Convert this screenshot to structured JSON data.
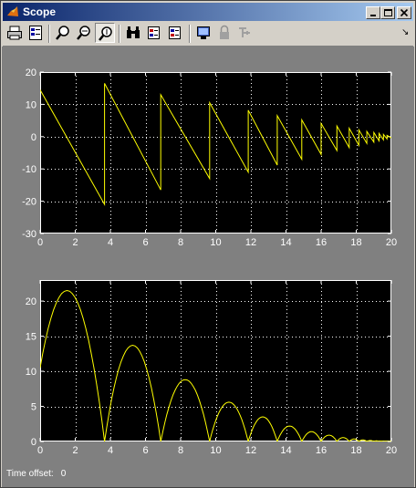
{
  "window": {
    "title": "Scope",
    "title_icon": "matlab-icon"
  },
  "toolbar": {
    "buttons": [
      {
        "name": "print-button",
        "icon": "printer-icon"
      },
      {
        "name": "parameters-button",
        "icon": "parameters-icon"
      },
      {
        "name": "zoom-button",
        "icon": "magnifier-zoom-icon"
      },
      {
        "name": "zoom-x-button",
        "icon": "magnifier-zoom-x-icon"
      },
      {
        "name": "zoom-y-button",
        "icon": "magnifier-zoom-y-icon",
        "pressed": true
      },
      {
        "name": "autoscale-button",
        "icon": "binoculars-icon"
      },
      {
        "name": "save-axes-button",
        "icon": "save-axes-icon"
      },
      {
        "name": "restore-axes-button",
        "icon": "restore-axes-icon"
      },
      {
        "name": "floating-scope-button",
        "icon": "floating-scope-icon"
      },
      {
        "name": "lock-axes-button",
        "icon": "lock-icon",
        "disabled": true
      },
      {
        "name": "signal-selector-button",
        "icon": "signal-selector-icon",
        "disabled": true
      }
    ],
    "menu_arrow": "↘"
  },
  "time_offset": {
    "label": "Time offset:",
    "value": "0"
  },
  "chart_data": [
    {
      "type": "line",
      "xlim": [
        0,
        20
      ],
      "ylim": [
        -30,
        20
      ],
      "xticks": [
        0,
        2,
        4,
        6,
        8,
        10,
        12,
        14,
        16,
        18,
        20
      ],
      "yticks": [
        -30,
        -20,
        -10,
        0,
        10,
        20
      ],
      "grid": true,
      "line_color": "#ffff00",
      "background": "#000000",
      "series": [
        {
          "x": [
            0,
            3.67,
            3.67,
            6.87,
            6.87,
            9.65,
            9.65,
            11.85,
            11.85,
            13.5,
            13.5,
            14.9,
            14.9,
            16.0,
            16.0,
            16.9,
            16.9,
            17.6,
            17.6,
            18.15,
            18.15,
            18.6,
            18.6,
            19.0,
            19.0,
            19.3,
            19.3,
            19.55,
            19.55,
            19.75,
            19.75,
            20
          ],
          "values": [
            14.5,
            -21,
            16.5,
            -16.5,
            13,
            -13,
            10.5,
            -11,
            8.2,
            -8.8,
            6.5,
            -7,
            5.2,
            -5.5,
            4.1,
            -4.3,
            3.3,
            -3.4,
            2.6,
            -2.7,
            2.1,
            -2.1,
            1.6,
            -1.7,
            1.3,
            -1.3,
            1.0,
            -1.0,
            0.7,
            -0.7,
            0.4,
            -0.4
          ]
        }
      ]
    },
    {
      "type": "line",
      "xlim": [
        0,
        20
      ],
      "ylim": [
        0,
        23
      ],
      "xticks": [
        0,
        2,
        4,
        6,
        8,
        10,
        12,
        14,
        16,
        18,
        20
      ],
      "yticks": [
        0,
        5,
        10,
        15,
        20
      ],
      "grid": true,
      "line_color": "#ffff00",
      "background": "#000000",
      "series": [
        {
          "x": [
            0,
            1.5,
            3.67,
            5.3,
            6.87,
            8.2,
            9.65,
            10.75,
            11.85,
            12.7,
            13.5,
            14.2,
            14.9,
            15.45,
            16.0,
            16.45,
            16.9,
            17.25,
            17.6,
            17.9,
            18.15,
            18.4,
            18.6,
            18.8,
            19.0,
            19.15,
            19.3,
            19.45,
            19.55,
            19.65,
            19.75,
            20
          ],
          "values": [
            10.5,
            21.5,
            0,
            13.7,
            0,
            8.8,
            0,
            5.6,
            0,
            3.5,
            0,
            2.2,
            0,
            1.4,
            0,
            0.9,
            0,
            0.55,
            0,
            0.35,
            0,
            0.22,
            0,
            0.14,
            0,
            0.09,
            0,
            0.06,
            0,
            0.04,
            0,
            0
          ]
        }
      ]
    }
  ]
}
